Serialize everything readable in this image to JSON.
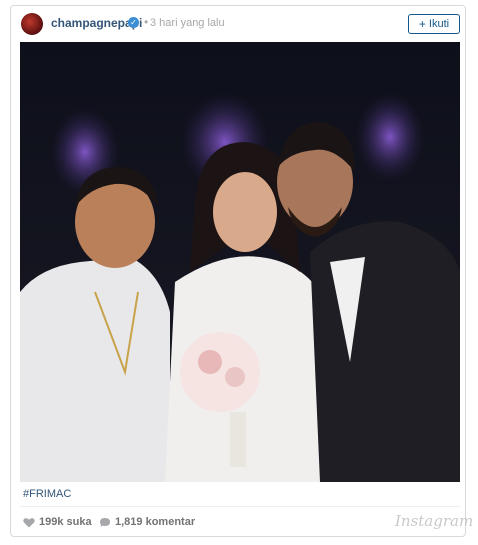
{
  "post": {
    "username": "champagnepapi",
    "verified_symbol": "✓",
    "separator": "•",
    "timestamp": "3 hari yang lalu",
    "follow_label": "Ikuti",
    "follow_plus": "+"
  },
  "caption": {
    "hashtag": "#FRIMAC"
  },
  "stats": {
    "likes": "199k suka",
    "comments": "1,819 komentar"
  },
  "branding": {
    "logo": "Instagram"
  },
  "icons": {
    "heart": "heart-icon",
    "comment": "comment-bubble-icon",
    "verified": "verified-badge-icon"
  },
  "colors": {
    "username": "#335577",
    "follow_border": "#125688",
    "verified": "#3b8ed3",
    "muted_text": "#a5a7aa"
  }
}
